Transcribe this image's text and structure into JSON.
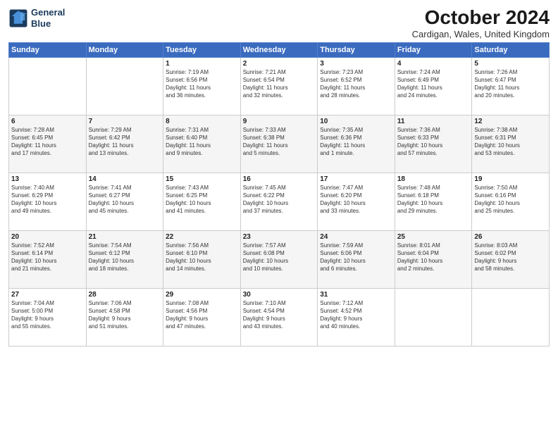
{
  "logo": {
    "line1": "General",
    "line2": "Blue"
  },
  "title": "October 2024",
  "location": "Cardigan, Wales, United Kingdom",
  "days_header": [
    "Sunday",
    "Monday",
    "Tuesday",
    "Wednesday",
    "Thursday",
    "Friday",
    "Saturday"
  ],
  "weeks": [
    [
      {
        "day": "",
        "content": ""
      },
      {
        "day": "",
        "content": ""
      },
      {
        "day": "1",
        "content": "Sunrise: 7:19 AM\nSunset: 6:56 PM\nDaylight: 11 hours\nand 36 minutes."
      },
      {
        "day": "2",
        "content": "Sunrise: 7:21 AM\nSunset: 6:54 PM\nDaylight: 11 hours\nand 32 minutes."
      },
      {
        "day": "3",
        "content": "Sunrise: 7:23 AM\nSunset: 6:52 PM\nDaylight: 11 hours\nand 28 minutes."
      },
      {
        "day": "4",
        "content": "Sunrise: 7:24 AM\nSunset: 6:49 PM\nDaylight: 11 hours\nand 24 minutes."
      },
      {
        "day": "5",
        "content": "Sunrise: 7:26 AM\nSunset: 6:47 PM\nDaylight: 11 hours\nand 20 minutes."
      }
    ],
    [
      {
        "day": "6",
        "content": "Sunrise: 7:28 AM\nSunset: 6:45 PM\nDaylight: 11 hours\nand 17 minutes."
      },
      {
        "day": "7",
        "content": "Sunrise: 7:29 AM\nSunset: 6:42 PM\nDaylight: 11 hours\nand 13 minutes."
      },
      {
        "day": "8",
        "content": "Sunrise: 7:31 AM\nSunset: 6:40 PM\nDaylight: 11 hours\nand 9 minutes."
      },
      {
        "day": "9",
        "content": "Sunrise: 7:33 AM\nSunset: 6:38 PM\nDaylight: 11 hours\nand 5 minutes."
      },
      {
        "day": "10",
        "content": "Sunrise: 7:35 AM\nSunset: 6:36 PM\nDaylight: 11 hours\nand 1 minute."
      },
      {
        "day": "11",
        "content": "Sunrise: 7:36 AM\nSunset: 6:33 PM\nDaylight: 10 hours\nand 57 minutes."
      },
      {
        "day": "12",
        "content": "Sunrise: 7:38 AM\nSunset: 6:31 PM\nDaylight: 10 hours\nand 53 minutes."
      }
    ],
    [
      {
        "day": "13",
        "content": "Sunrise: 7:40 AM\nSunset: 6:29 PM\nDaylight: 10 hours\nand 49 minutes."
      },
      {
        "day": "14",
        "content": "Sunrise: 7:41 AM\nSunset: 6:27 PM\nDaylight: 10 hours\nand 45 minutes."
      },
      {
        "day": "15",
        "content": "Sunrise: 7:43 AM\nSunset: 6:25 PM\nDaylight: 10 hours\nand 41 minutes."
      },
      {
        "day": "16",
        "content": "Sunrise: 7:45 AM\nSunset: 6:22 PM\nDaylight: 10 hours\nand 37 minutes."
      },
      {
        "day": "17",
        "content": "Sunrise: 7:47 AM\nSunset: 6:20 PM\nDaylight: 10 hours\nand 33 minutes."
      },
      {
        "day": "18",
        "content": "Sunrise: 7:48 AM\nSunset: 6:18 PM\nDaylight: 10 hours\nand 29 minutes."
      },
      {
        "day": "19",
        "content": "Sunrise: 7:50 AM\nSunset: 6:16 PM\nDaylight: 10 hours\nand 25 minutes."
      }
    ],
    [
      {
        "day": "20",
        "content": "Sunrise: 7:52 AM\nSunset: 6:14 PM\nDaylight: 10 hours\nand 21 minutes."
      },
      {
        "day": "21",
        "content": "Sunrise: 7:54 AM\nSunset: 6:12 PM\nDaylight: 10 hours\nand 18 minutes."
      },
      {
        "day": "22",
        "content": "Sunrise: 7:56 AM\nSunset: 6:10 PM\nDaylight: 10 hours\nand 14 minutes."
      },
      {
        "day": "23",
        "content": "Sunrise: 7:57 AM\nSunset: 6:08 PM\nDaylight: 10 hours\nand 10 minutes."
      },
      {
        "day": "24",
        "content": "Sunrise: 7:59 AM\nSunset: 6:06 PM\nDaylight: 10 hours\nand 6 minutes."
      },
      {
        "day": "25",
        "content": "Sunrise: 8:01 AM\nSunset: 6:04 PM\nDaylight: 10 hours\nand 2 minutes."
      },
      {
        "day": "26",
        "content": "Sunrise: 8:03 AM\nSunset: 6:02 PM\nDaylight: 9 hours\nand 58 minutes."
      }
    ],
    [
      {
        "day": "27",
        "content": "Sunrise: 7:04 AM\nSunset: 5:00 PM\nDaylight: 9 hours\nand 55 minutes."
      },
      {
        "day": "28",
        "content": "Sunrise: 7:06 AM\nSunset: 4:58 PM\nDaylight: 9 hours\nand 51 minutes."
      },
      {
        "day": "29",
        "content": "Sunrise: 7:08 AM\nSunset: 4:56 PM\nDaylight: 9 hours\nand 47 minutes."
      },
      {
        "day": "30",
        "content": "Sunrise: 7:10 AM\nSunset: 4:54 PM\nDaylight: 9 hours\nand 43 minutes."
      },
      {
        "day": "31",
        "content": "Sunrise: 7:12 AM\nSunset: 4:52 PM\nDaylight: 9 hours\nand 40 minutes."
      },
      {
        "day": "",
        "content": ""
      },
      {
        "day": "",
        "content": ""
      }
    ]
  ]
}
